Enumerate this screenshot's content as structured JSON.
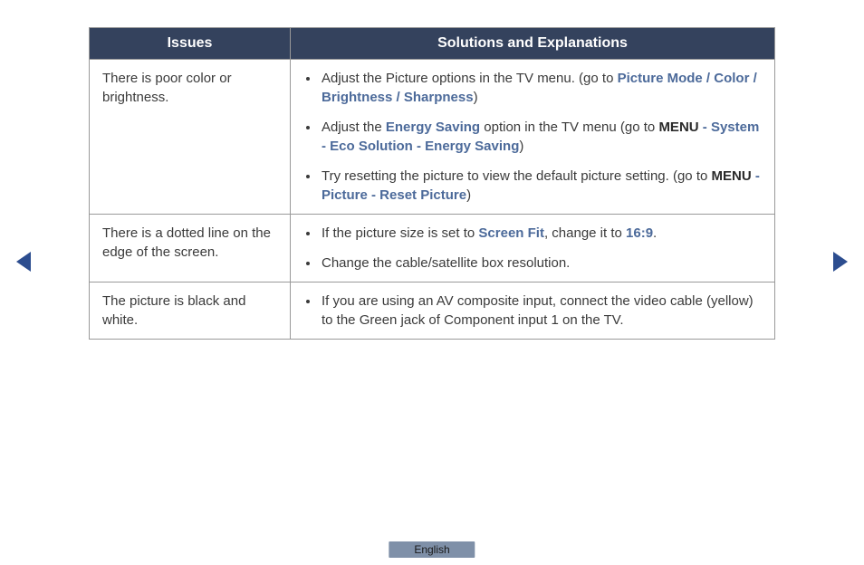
{
  "headers": {
    "issues": "Issues",
    "solutions": "Solutions and Explanations"
  },
  "rows": [
    {
      "issue": "There is poor color or brightness.",
      "items": [
        {
          "segments": [
            {
              "t": "Adjust the Picture options in the TV menu. (go to "
            },
            {
              "t": "Picture Mode / Color / Brightness / Sharpness",
              "cls": "hl"
            },
            {
              "t": ")"
            }
          ]
        },
        {
          "segments": [
            {
              "t": "Adjust the "
            },
            {
              "t": "Energy Saving",
              "cls": "hl"
            },
            {
              "t": " option in the TV menu (go to "
            },
            {
              "t": "MENU",
              "cls": "bold"
            },
            {
              "t": " - ",
              "cls": "hl"
            },
            {
              "t": "System - Eco Solution - Energy Saving",
              "cls": "hl"
            },
            {
              "t": ")"
            }
          ]
        },
        {
          "segments": [
            {
              "t": "Try resetting the picture to view the default picture setting. (go to "
            },
            {
              "t": "MENU",
              "cls": "bold"
            },
            {
              "t": " - Picture - Reset Picture",
              "cls": "hl"
            },
            {
              "t": ")"
            }
          ]
        }
      ]
    },
    {
      "issue": "There is a dotted line on the edge of the screen.",
      "items": [
        {
          "segments": [
            {
              "t": "If the picture size is set to "
            },
            {
              "t": "Screen Fit",
              "cls": "hl"
            },
            {
              "t": ", change it to "
            },
            {
              "t": "16:9",
              "cls": "hl"
            },
            {
              "t": "."
            }
          ]
        },
        {
          "segments": [
            {
              "t": "Change the cable/satellite box resolution."
            }
          ]
        }
      ]
    },
    {
      "issue": "The picture is black and white.",
      "items": [
        {
          "segments": [
            {
              "t": "If you are using an AV composite input, connect the video cable (yellow) to the Green jack of Component input 1 on the TV."
            }
          ]
        }
      ]
    }
  ],
  "nav": {
    "prev": "Previous page",
    "next": "Next page"
  },
  "language": "English"
}
